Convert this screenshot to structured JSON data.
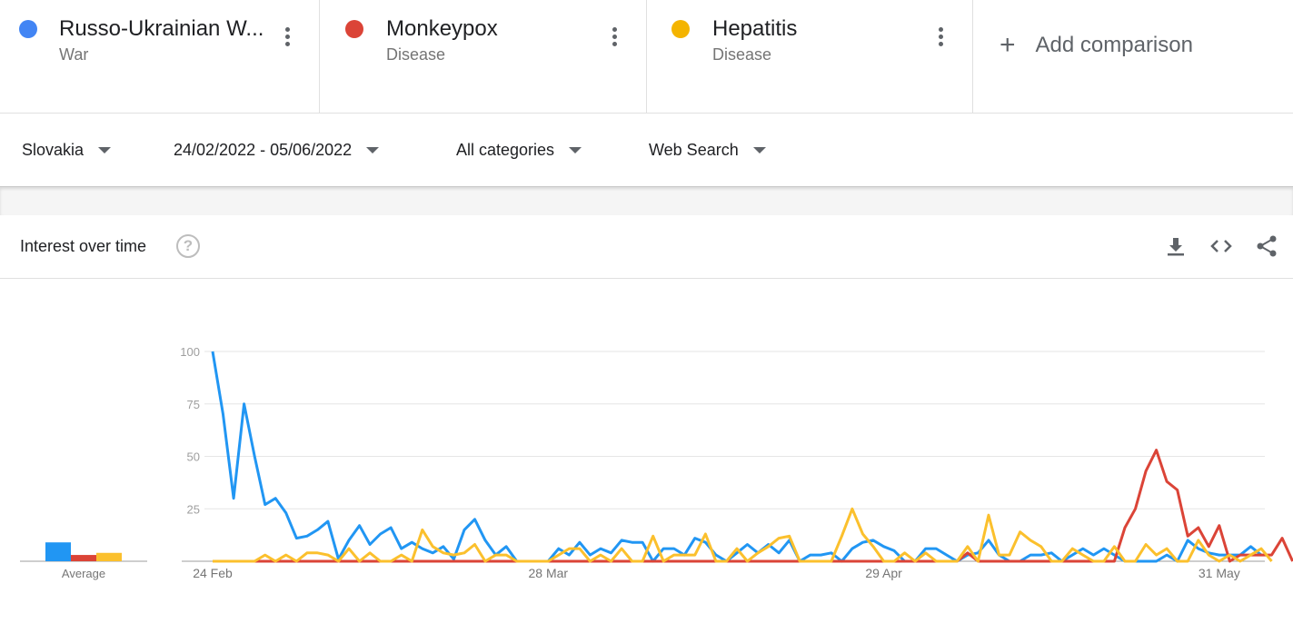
{
  "terms": [
    {
      "name": "Russo-Ukrainian W...",
      "type": "War",
      "color": "#4285f4"
    },
    {
      "name": "Monkeypox",
      "type": "Disease",
      "color": "#db4437"
    },
    {
      "name": "Hepatitis",
      "type": "Disease",
      "color": "#f4b400"
    }
  ],
  "add_comparison": {
    "icon": "plus-icon",
    "label": "Add comparison"
  },
  "filters": {
    "region": "Slovakia",
    "date_range": "24/02/2022 - 05/06/2022",
    "category": "All categories",
    "search_type": "Web Search"
  },
  "card": {
    "title": "Interest over time",
    "icons": [
      "help-icon",
      "download-icon",
      "embed-icon",
      "share-icon"
    ]
  },
  "chart_data": {
    "type": "line",
    "ylim": [
      0,
      100
    ],
    "yticks": [
      "100",
      "75",
      "50",
      "25"
    ],
    "xticks": [
      {
        "label": "24 Feb",
        "index": 0
      },
      {
        "label": "28 Mar",
        "index": 32
      },
      {
        "label": "29 Apr",
        "index": 64
      },
      {
        "label": "31 May",
        "index": 96
      }
    ],
    "grid": true,
    "average": {
      "label": "Average",
      "values": [
        9,
        3,
        4
      ]
    },
    "series": [
      {
        "name": "Russo-Ukrainian W...",
        "color": "#2196f3",
        "values": [
          100,
          70,
          30,
          75,
          50,
          27,
          30,
          23,
          11,
          12,
          15,
          19,
          1,
          10,
          17,
          8,
          13,
          16,
          6,
          9,
          6,
          4,
          7,
          1,
          15,
          20,
          10,
          3,
          7,
          0,
          0,
          0,
          0,
          6,
          3,
          9,
          3,
          6,
          4,
          10,
          9,
          9,
          0,
          6,
          6,
          3,
          11,
          9,
          3,
          0,
          4,
          8,
          4,
          8,
          4,
          10,
          0,
          3,
          3,
          4,
          0,
          6,
          9,
          10,
          7,
          5,
          0,
          0,
          6,
          6,
          3,
          0,
          3,
          4,
          10,
          3,
          0,
          0,
          3,
          3,
          4,
          0,
          3,
          6,
          3,
          6,
          3,
          0,
          0,
          0,
          0,
          3,
          0,
          10,
          6,
          4,
          3,
          3,
          3,
          7,
          3
        ]
      },
      {
        "name": "Monkeypox",
        "color": "#db4437",
        "values": [
          0,
          0,
          0,
          0,
          0,
          0,
          0,
          0,
          0,
          0,
          0,
          0,
          0,
          0,
          0,
          0,
          0,
          0,
          0,
          0,
          0,
          0,
          0,
          0,
          0,
          0,
          0,
          0,
          0,
          0,
          0,
          0,
          0,
          0,
          0,
          0,
          0,
          0,
          0,
          0,
          0,
          0,
          0,
          0,
          0,
          0,
          0,
          0,
          0,
          0,
          0,
          0,
          0,
          0,
          0,
          0,
          0,
          0,
          0,
          0,
          0,
          0,
          0,
          0,
          0,
          0,
          0,
          0,
          0,
          0,
          0,
          0,
          4,
          0,
          0,
          0,
          0,
          0,
          0,
          0,
          0,
          0,
          0,
          0,
          0,
          0,
          0,
          16,
          25,
          43,
          53,
          38,
          34,
          12,
          16,
          7,
          17,
          0,
          3,
          3,
          3,
          3,
          11,
          0
        ]
      },
      {
        "name": "Hepatitis",
        "color": "#fbc02d",
        "values": [
          0,
          0,
          0,
          0,
          0,
          3,
          0,
          3,
          0,
          4,
          4,
          3,
          0,
          6,
          0,
          4,
          0,
          0,
          3,
          0,
          15,
          7,
          4,
          3,
          4,
          8,
          0,
          3,
          3,
          0,
          0,
          0,
          0,
          3,
          6,
          6,
          0,
          3,
          0,
          6,
          0,
          0,
          12,
          0,
          3,
          3,
          3,
          13,
          0,
          0,
          6,
          0,
          4,
          7,
          11,
          12,
          0,
          0,
          0,
          0,
          12,
          25,
          13,
          7,
          0,
          0,
          4,
          0,
          4,
          0,
          0,
          0,
          7,
          0,
          22,
          3,
          3,
          14,
          10,
          7,
          0,
          0,
          6,
          3,
          0,
          0,
          7,
          0,
          0,
          8,
          3,
          6,
          0,
          0,
          10,
          3,
          0,
          3,
          0,
          3,
          6,
          0
        ]
      }
    ]
  }
}
